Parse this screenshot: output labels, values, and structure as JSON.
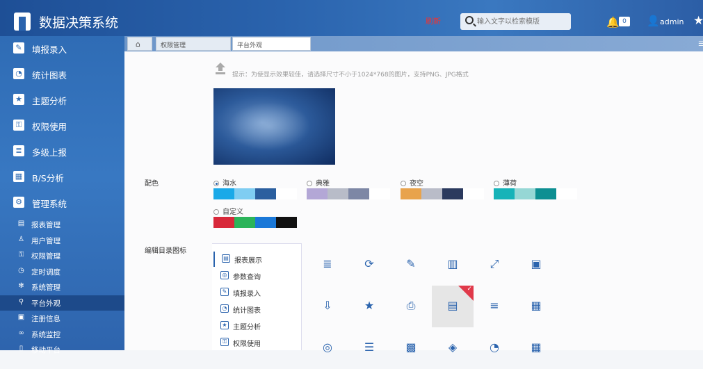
{
  "app": {
    "title": "数据决策系统",
    "red_label": "刷新"
  },
  "search": {
    "placeholder": "输入文字以检索模版"
  },
  "header": {
    "notification_count": "0",
    "user_name": "admin"
  },
  "sidebar": {
    "main_items": [
      {
        "label": "填报录入",
        "icon": "edit-icon"
      },
      {
        "label": "统计图表",
        "icon": "pie-chart-icon"
      },
      {
        "label": "主题分析",
        "icon": "star-icon"
      },
      {
        "label": "权限使用",
        "icon": "key-icon"
      },
      {
        "label": "多级上报",
        "icon": "list-icon"
      },
      {
        "label": "B/S分析",
        "icon": "grid-icon"
      },
      {
        "label": "管理系统",
        "icon": "gear-icon"
      }
    ],
    "sub_items": [
      {
        "label": "报表管理",
        "icon": "report-icon"
      },
      {
        "label": "用户管理",
        "icon": "user-icon"
      },
      {
        "label": "权限管理",
        "icon": "lock-icon"
      },
      {
        "label": "定时调度",
        "icon": "clock-icon"
      },
      {
        "label": "系统管理",
        "icon": "cog-icon"
      },
      {
        "label": "平台外观",
        "icon": "brush-icon",
        "active": true
      },
      {
        "label": "注册信息",
        "icon": "register-icon"
      },
      {
        "label": "系统监控",
        "icon": "monitor-icon"
      },
      {
        "label": "移动平台",
        "icon": "mobile-icon"
      }
    ]
  },
  "tabs": [
    {
      "label": "权限管理"
    },
    {
      "label": "平台外观",
      "active": true
    }
  ],
  "upload": {
    "hint": "提示：为使显示效果较佳，请选择尺寸不小于1024*768的图片，支持PNG、JPG格式"
  },
  "color_scheme": {
    "label": "配色",
    "options": [
      {
        "name": "海水",
        "selected": true,
        "colors": [
          "#1aa9e8",
          "#7fcdf2",
          "#2b5f9f",
          "#ffffff"
        ]
      },
      {
        "name": "典雅",
        "selected": false,
        "colors": [
          "#b3a7d6",
          "#b8bcc8",
          "#7d87a5",
          "#ffffff"
        ]
      },
      {
        "name": "夜空",
        "selected": false,
        "colors": [
          "#e8a34c",
          "#b9bcc8",
          "#2b3a5e",
          "#ffffff"
        ]
      },
      {
        "name": "薄荷",
        "selected": false,
        "colors": [
          "#16b3b8",
          "#96d7d5",
          "#0d8f92",
          "#ffffff"
        ]
      },
      {
        "name": "自定义",
        "selected": false,
        "colors": [
          "#d8283a",
          "#2bb45a",
          "#1a78d8",
          "#111111"
        ]
      }
    ]
  },
  "directory_icons": {
    "label": "编辑目录图标",
    "tree": [
      {
        "label": "报表展示",
        "icon": "report-display-icon",
        "active": true
      },
      {
        "label": "参数查询",
        "icon": "query-icon"
      },
      {
        "label": "填报录入",
        "icon": "edit-icon"
      },
      {
        "label": "统计图表",
        "icon": "pie-chart-icon"
      },
      {
        "label": "主题分析",
        "icon": "star-icon"
      },
      {
        "label": "权限使用",
        "icon": "key-icon"
      }
    ],
    "grid": [
      {
        "icon": "document-lines-icon",
        "glyph": "≣"
      },
      {
        "icon": "search-refresh-icon",
        "glyph": "⟳"
      },
      {
        "icon": "pencil-edit-icon",
        "glyph": "✎"
      },
      {
        "icon": "bar-chart-icon",
        "glyph": "▥"
      },
      {
        "icon": "expand-arrows-icon",
        "glyph": "⤢"
      },
      {
        "icon": "book-stack-icon",
        "glyph": "▣"
      },
      {
        "icon": "inbox-download-icon",
        "glyph": "⇩"
      },
      {
        "icon": "star-box-icon",
        "glyph": "★"
      },
      {
        "icon": "printer-icon",
        "glyph": "⎙"
      },
      {
        "icon": "card-panel-icon",
        "glyph": "▤",
        "selected": true
      },
      {
        "icon": "document-text-icon",
        "glyph": "≡"
      },
      {
        "icon": "form-icon",
        "glyph": "▦"
      },
      {
        "icon": "camera-box-icon",
        "glyph": "◎"
      },
      {
        "icon": "list-lines-icon",
        "glyph": "☰"
      },
      {
        "icon": "apps-grid-icon",
        "glyph": "▩"
      },
      {
        "icon": "target-icon",
        "glyph": "◈"
      },
      {
        "icon": "pie-icon",
        "glyph": "◔"
      },
      {
        "icon": "calendar-icon",
        "glyph": "▦"
      }
    ]
  }
}
